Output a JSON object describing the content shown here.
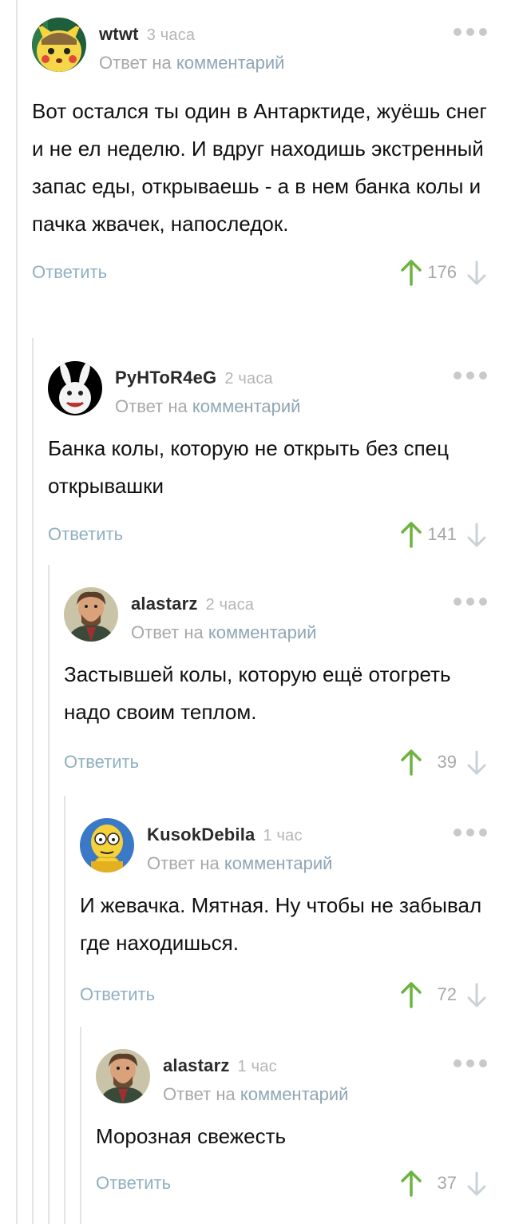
{
  "colors": {
    "upvote": "#6db33f",
    "downvote": "#c9d2d7",
    "link": "#8fa6b4",
    "reply": "#8fb0c0",
    "thread_line": "#e4e4e4"
  },
  "comments": [
    {
      "author": "wtwt",
      "time": "3 часа",
      "reply_prefix": "Ответ на",
      "reply_link": "комментарий",
      "text": "Вот остался ты один в Антарктиде, жуёшь снег и не ел неделю. И вдруг находишь экстренный запас еды, открываешь - а в нем банка колы и пачка жвачек, напоследок.",
      "reply_label": "Ответить",
      "score": "176",
      "avatar_icon": "pikachu-avatar-icon"
    },
    {
      "author": "PyHToR4eG",
      "time": "2 часа",
      "reply_prefix": "Ответ на",
      "reply_link": "комментарий",
      "text": "Банка колы, которую не открыть без спец открывашки",
      "reply_label": "Ответить",
      "score": "141",
      "avatar_icon": "rabbid-avatar-icon"
    },
    {
      "author": "alastarz",
      "time": "2 часа",
      "reply_prefix": "Ответ на",
      "reply_link": "комментарий",
      "text": "Застывшей колы, которую ещё отогреть надо своим теплом.",
      "reply_label": "Ответить",
      "score": "39",
      "avatar_icon": "portrait-avatar-icon"
    },
    {
      "author": "KusokDebila",
      "time": "1 час",
      "reply_prefix": "Ответ на",
      "reply_link": "комментарий",
      "text": "И жевачка. Мятная. Ну чтобы не забывал где находишься.",
      "reply_label": "Ответить",
      "score": "72",
      "avatar_icon": "cartoon-avatar-icon"
    },
    {
      "author": "alastarz",
      "time": "1 час",
      "reply_prefix": "Ответ на",
      "reply_link": "комментарий",
      "text": "Морозная свежесть",
      "reply_label": "Ответить",
      "score": "37",
      "avatar_icon": "portrait-avatar-icon"
    }
  ]
}
